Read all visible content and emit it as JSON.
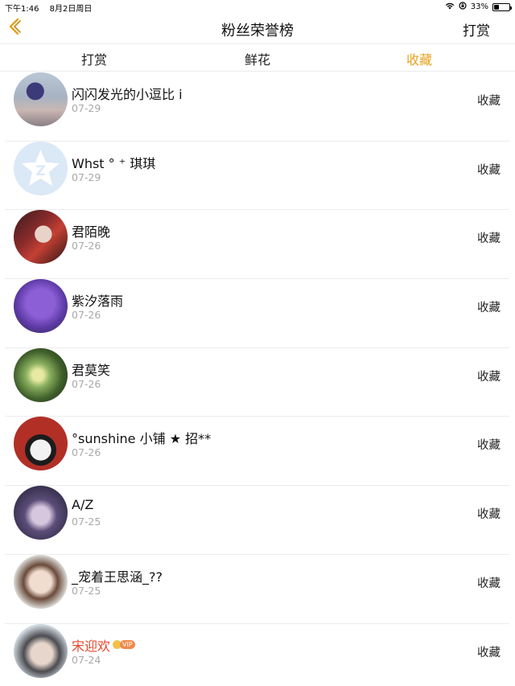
{
  "status_bar": {
    "time": "下午1:46",
    "date": "8月2日周日",
    "battery": "33%",
    "battery_level": 0.33
  },
  "nav": {
    "back_icon": "chevron-left-icon",
    "title": "粉丝荣誉榜",
    "right_label": "打赏"
  },
  "tabs": [
    {
      "label": "打赏",
      "active": false
    },
    {
      "label": "鲜花",
      "active": false
    },
    {
      "label": "收藏",
      "active": true
    }
  ],
  "colors": {
    "accent": "#e6a11d",
    "vip_name": "#e8462a"
  },
  "list": [
    {
      "name": "闪闪发光的小逗比 i",
      "date": "07-29",
      "action": "收藏"
    },
    {
      "name": "Whst ° ⁺ 琪琪",
      "date": "07-29",
      "action": "收藏"
    },
    {
      "name": "君陌晚",
      "date": "07-26",
      "action": "收藏"
    },
    {
      "name": "紫汐落雨",
      "date": "07-26",
      "action": "收藏"
    },
    {
      "name": "君莫笑",
      "date": "07-26",
      "action": "收藏"
    },
    {
      "name": "°sunshine 小铺 ★ 招**",
      "date": "07-26",
      "action": "收藏"
    },
    {
      "name": "A/Z",
      "date": "07-25",
      "action": "收藏"
    },
    {
      "name": "_宠着王思涵_??",
      "date": "07-25",
      "action": "收藏"
    },
    {
      "name": "宋迎欢",
      "date": "07-24",
      "action": "收藏",
      "vip": true,
      "vip_label": "VIP"
    }
  ]
}
